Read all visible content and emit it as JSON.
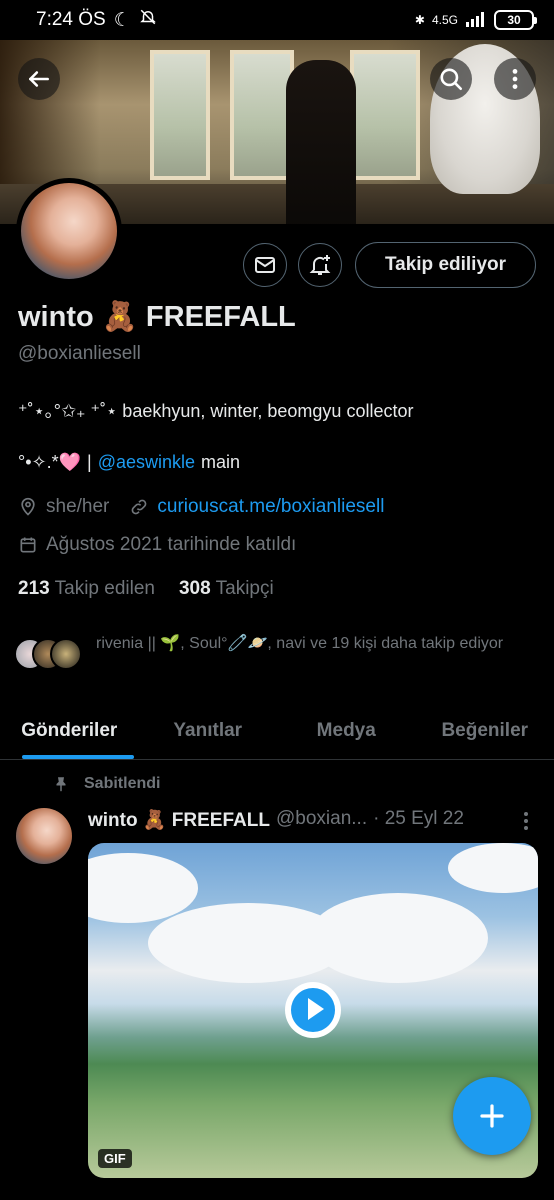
{
  "status": {
    "time": "7:24 ÖS",
    "network": "4.5G",
    "battery": "30"
  },
  "header": {
    "back_icon": "arrow-left-icon",
    "search_icon": "search-icon",
    "more_icon": "more-vertical-icon"
  },
  "profile": {
    "display_name": "winto 🧸 FREEFALL",
    "handle": "@boxianliesell",
    "follow_button": "Takip ediliyor",
    "bio_line1": "⁺˚⋆｡°✩₊ ⁺˚⋆ baekhyun, winter, beomgyu collector",
    "bio_line2_prefix": "°•✧.*🩷",
    "bio_line2_sep": "|",
    "bio_line2_mention": "@aeswinkle",
    "bio_line2_suffix": "main",
    "pronouns": "she/her",
    "website": "curiouscat.me/boxianliesell",
    "joined": "Ağustos 2021 tarihinde katıldı",
    "following_count": "213",
    "following_label": "Takip edilen",
    "followers_count": "308",
    "followers_label": "Takipçi",
    "known_followers": "rivenia || 🌱, Soul°🧷🪐, navi ve 19 kişi daha takip ediyor"
  },
  "tabs": [
    {
      "label": "Gönderiler",
      "active": true
    },
    {
      "label": "Yanıtlar",
      "active": false
    },
    {
      "label": "Medya",
      "active": false
    },
    {
      "label": "Beğeniler",
      "active": false
    }
  ],
  "tweet": {
    "pinned_label": "Sabitlendi",
    "author_name": "winto 🧸 FREEFALL",
    "author_handle": "@boxian...",
    "time": "· 25 Eyl 22",
    "media_badge": "GIF"
  },
  "colors": {
    "accent": "#1d9bf0",
    "background": "#000000",
    "muted": "#71767b"
  }
}
